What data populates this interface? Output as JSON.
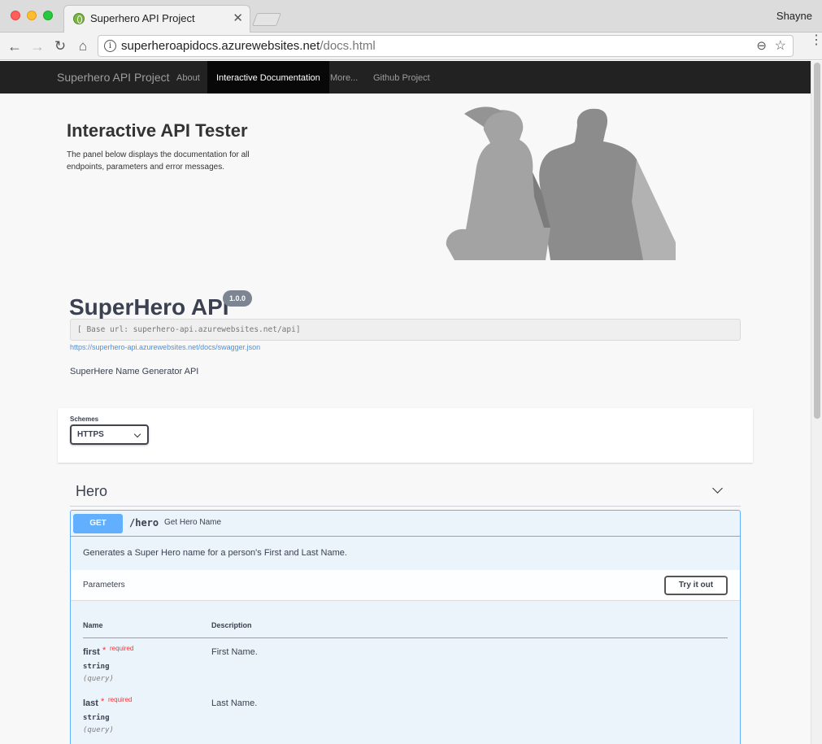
{
  "browser": {
    "tab_title": "Superhero API Project",
    "tab_close": "✕",
    "profile_name": "Shayne",
    "url_host": "superheroapidocs.azurewebsites.net",
    "url_path": "/docs.html",
    "icons": [
      "back-arrow-icon",
      "forward-arrow-icon",
      "reload-icon",
      "home-icon",
      "info-icon",
      "zoom-out-icon",
      "star-icon",
      "menu-icon"
    ]
  },
  "site_nav": {
    "brand": "Superhero API Project",
    "links": [
      {
        "label": "About",
        "active": false
      },
      {
        "label": "Interactive Documentation",
        "active": true
      },
      {
        "label": "More...",
        "active": false
      },
      {
        "label": "Github Project",
        "active": false
      }
    ]
  },
  "hero": {
    "title": "Interactive API Tester",
    "description": "The panel below displays the documentation for all endpoints, parameters and error messages."
  },
  "api": {
    "title": "SuperHero API",
    "version": "1.0.0",
    "base_url": "[ Base url: superhero-api.azurewebsites.net/api]",
    "spec_link": "https://superhero-api.azurewebsites.net/docs/swagger.json",
    "description": "SuperHere Name Generator API"
  },
  "schemes": {
    "label": "Schemes",
    "selected": "HTTPS"
  },
  "tag": {
    "name": "Hero",
    "operation": {
      "method": "GET",
      "path": "/hero",
      "summary": "Get Hero Name",
      "description": "Generates a Super Hero name for a person's First and Last Name.",
      "parameters_title": "Parameters",
      "try_button": "Try it out",
      "columns": {
        "name": "Name",
        "description": "Description"
      },
      "params": [
        {
          "name": "first",
          "star": "*",
          "required": "required",
          "type": "string",
          "in": "(query)",
          "description": "First Name."
        },
        {
          "name": "last",
          "star": "*",
          "required": "required",
          "type": "string",
          "in": "(query)",
          "description": "Last Name."
        }
      ]
    }
  },
  "colors": {
    "get_method": "#61affe",
    "nav_bg": "#222222",
    "required": "#ff3131"
  }
}
